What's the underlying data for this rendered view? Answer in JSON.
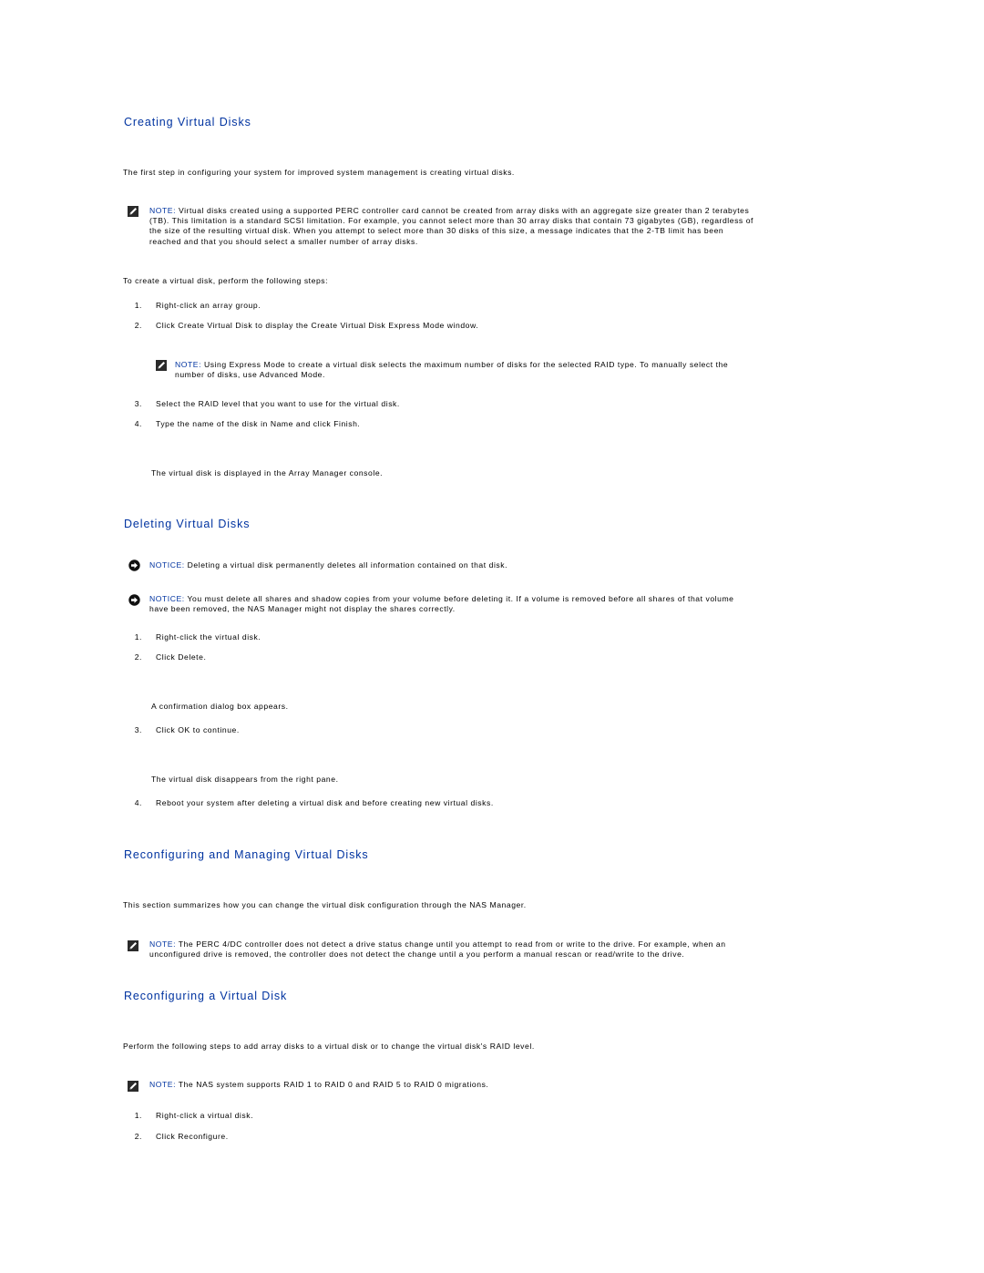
{
  "sections": {
    "creating": {
      "heading": "Creating Virtual Disks",
      "intro": "The first step in configuring your system for improved system management is creating virtual disks.",
      "note": {
        "label": "NOTE:",
        "lines": [
          " Virtual disks created using a supported PERC controller card cannot be created from array disks with an aggregate size greater than 2 terabytes",
          "(TB). This limitation is a standard SCSI limitation. For example, you cannot select more than 30 array disks that contain 73 gigabytes (GB), regardless of",
          "the size of the resulting virtual disk. When you attempt to select more than 30 disks of this size, a message indicates that the 2-TB limit has been",
          "reached and that you should select a smaller number of array disks."
        ]
      },
      "steps_intro": "To create a virtual disk, perform the following steps:",
      "steps": [
        {
          "num": "1.",
          "text": "Right-click an array group."
        },
        {
          "num": "2.",
          "text": "Click Create Virtual Disk to display the Create Virtual Disk Express Mode window."
        },
        {
          "num": "3.",
          "text": "Select the RAID level that you want to use for the virtual disk."
        },
        {
          "num": "4.",
          "text": "Type the name of the disk in Name and click Finish."
        }
      ],
      "step_note": {
        "label": "NOTE:",
        "lines": [
          " Using Express Mode to create a virtual disk selects the maximum number of disks for the selected RAID type. To manually select the",
          "number of disks, use Advanced Mode."
        ]
      },
      "result": "The virtual disk is displayed in the Array Manager console."
    },
    "deleting": {
      "heading": "Deleting Virtual Disks",
      "notice1": {
        "label": "NOTICE:",
        "text": " Deleting a virtual disk permanently deletes all information contained on that disk."
      },
      "notice2": {
        "label": "NOTICE:",
        "lines": [
          " You must delete all shares and shadow copies from your volume before deleting it. If a volume is removed before all shares of that volume",
          "have been removed, the NAS Manager might not display the shares correctly."
        ]
      },
      "steps": [
        {
          "num": "1.",
          "text": "Right-click the virtual disk."
        },
        {
          "num": "2.",
          "text": "Click Delete."
        },
        {
          "num": "3.",
          "text": "Click OK to continue."
        },
        {
          "num": "4.",
          "text": "Reboot your system after deleting a virtual disk and before creating new virtual disks."
        }
      ],
      "result_after_2": "A confirmation dialog box appears.",
      "result_after_3": "The virtual disk disappears from the right pane."
    },
    "reconfiguring_managing": {
      "heading": "Reconfiguring and Managing Virtual Disks",
      "intro": "This section summarizes how you can change the virtual disk configuration through the NAS Manager.",
      "note": {
        "label": "NOTE:",
        "lines": [
          " The PERC 4/DC controller does not detect a drive status change until you attempt to read from or write to the drive. For example, when an",
          "unconfigured drive is removed, the controller does not detect the change until a you perform a manual rescan or read/write to the drive."
        ]
      }
    },
    "reconfiguring_vd": {
      "heading": "Reconfiguring a Virtual Disk",
      "intro": "Perform the following steps to add array disks to a virtual disk or to change the virtual disk's RAID level.",
      "note": {
        "label": "NOTE:",
        "text": " The NAS system supports RAID 1 to RAID 0 and RAID 5 to RAID 0 migrations."
      },
      "steps": [
        {
          "num": "1.",
          "text": "Right-click a virtual disk."
        },
        {
          "num": "2.",
          "text": "Click Reconfigure."
        }
      ]
    }
  },
  "colors": {
    "heading": "#0033a0",
    "label": "#0033a0",
    "text": "#000000"
  },
  "icons": {
    "note": "pencil-note-icon",
    "notice": "notice-arrow-icon"
  }
}
